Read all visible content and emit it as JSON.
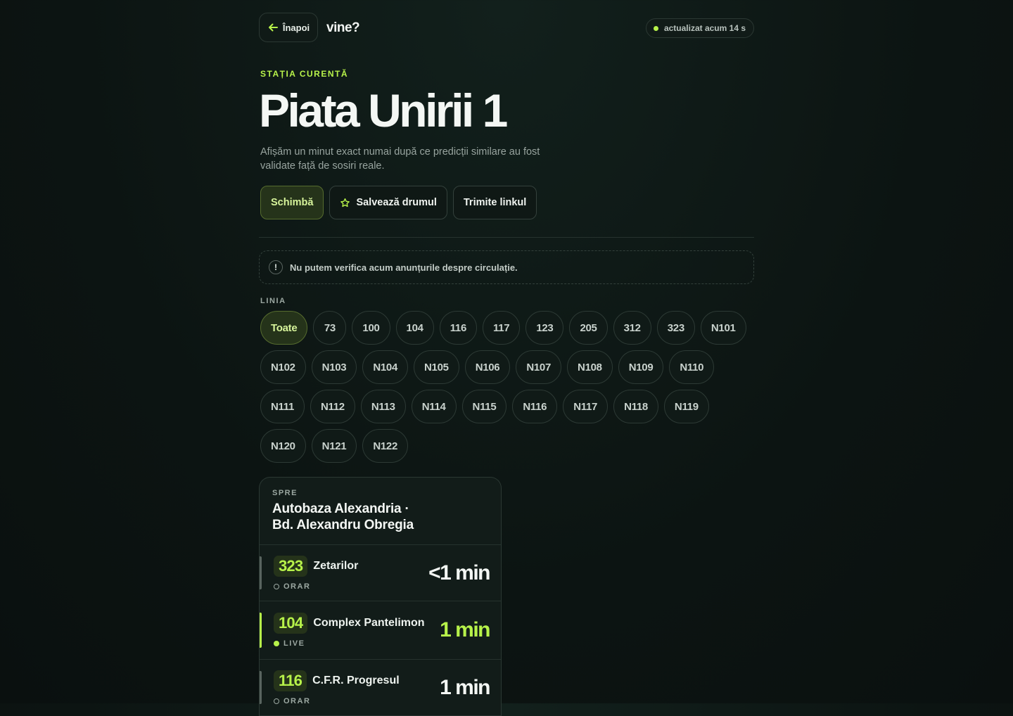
{
  "header": {
    "back_label": "Înapoi",
    "logo": "vine?",
    "status": "actualizat acum 14 s"
  },
  "station": {
    "eyebrow": "STAȚIA CURENTĂ",
    "name": "Piata Unirii 1",
    "description": "Afișăm un minut exact numai după ce predicții similare au fost validate față de sosiri reale."
  },
  "actions": {
    "change": "Schimbă",
    "save": "Salvează drumul",
    "share": "Trimite linkul"
  },
  "notice": {
    "icon": "!",
    "text": "Nu putem verifica acum anunțurile despre circulație."
  },
  "filter": {
    "label": "LINIA",
    "lines": [
      "Toate",
      "73",
      "100",
      "104",
      "116",
      "117",
      "123",
      "205",
      "312",
      "323",
      "N101",
      "N102",
      "N103",
      "N104",
      "N105",
      "N106",
      "N107",
      "N108",
      "N109",
      "N110",
      "N111",
      "N112",
      "N113",
      "N114",
      "N115",
      "N116",
      "N117",
      "N118",
      "N119",
      "N120",
      "N121",
      "N122"
    ],
    "selected": "Toate"
  },
  "card": {
    "eyebrow": "SPRE",
    "title_line1": "Autobaza Alexandria ·",
    "title_line2": "Bd. Alexandru Obregia",
    "arrivals": [
      {
        "line": "323",
        "destination": "Zetarilor",
        "kind": "ORAR",
        "eta": "<1 min",
        "live": false
      },
      {
        "line": "104",
        "destination": "Complex Pantelimon",
        "kind": "LIVE",
        "eta": "1 min",
        "live": true
      },
      {
        "line": "116",
        "destination": "C.F.R. Progresul",
        "kind": "ORAR",
        "eta": "1 min",
        "live": false
      }
    ]
  },
  "colors": {
    "accent": "#b7f24a",
    "background": "#0c1412",
    "surface": "#121c19"
  }
}
